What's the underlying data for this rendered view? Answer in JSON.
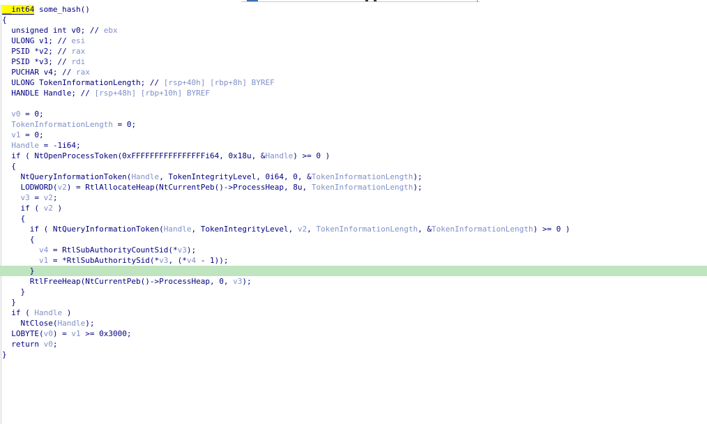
{
  "function_header": {
    "return_type": "__int64",
    "signature": " some_hash()"
  },
  "lines": [
    "{",
    "  unsigned int v0; // ebx",
    "  ULONG v1; // esi",
    "  PSID *v2; // rax",
    "  PSID *v3; // rdi",
    "  PUCHAR v4; // rax",
    "  ULONG TokenInformationLength; // [rsp+40h] [rbp+8h] BYREF",
    "  HANDLE Handle; // [rsp+48h] [rbp+10h] BYREF",
    "",
    "  v0 = 0;",
    "  TokenInformationLength = 0;",
    "  v1 = 0;",
    "  Handle = -1i64;",
    "  if ( NtOpenProcessToken(0xFFFFFFFFFFFFFFFFi64, 0x18u, &Handle) >= 0 )",
    "  {",
    "    NtQueryInformationToken(Handle, TokenIntegrityLevel, 0i64, 0, &TokenInformationLength);",
    "    LODWORD(v2) = RtlAllocateHeap(NtCurrentPeb()->ProcessHeap, 8u, TokenInformationLength);",
    "    v3 = v2;",
    "    if ( v2 )",
    "    {",
    "      if ( NtQueryInformationToken(Handle, TokenIntegrityLevel, v2, TokenInformationLength, &TokenInformationLength) >= 0 )",
    "      {",
    "        v4 = RtlSubAuthorityCountSid(*v3);",
    "        v1 = *RtlSubAuthoritySid(*v3, (*v4 - 1));",
    "      }",
    "      RtlFreeHeap(NtCurrentPeb()->ProcessHeap, 0, v3);",
    "    }",
    "  }",
    "  if ( Handle )",
    "    NtClose(Handle);",
    "  LOBYTE(v0) = v1 >= 0x3000;",
    "  return v0;",
    "}"
  ],
  "highlighted_line_index": 24,
  "colors": {
    "code_text": "#000080",
    "variable_and_comment": "#8090c8",
    "current_line_background": "#c0e4c0",
    "type_highlight": "#ffff00"
  }
}
